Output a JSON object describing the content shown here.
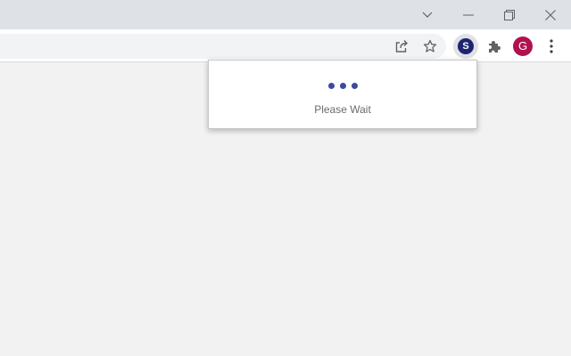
{
  "window": {
    "controls": [
      {
        "name": "tab-search",
        "icon": "chevron-down-icon"
      },
      {
        "name": "minimize",
        "icon": "minimize-icon"
      },
      {
        "name": "restore",
        "icon": "restore-icon"
      },
      {
        "name": "close",
        "icon": "close-icon"
      }
    ]
  },
  "toolbar": {
    "share_icon": "share-icon",
    "bookmark_icon": "star-icon",
    "extension_badge": "S",
    "extension_color": "#1d2570",
    "extensions_icon": "puzzle-icon",
    "profile_initial": "G",
    "profile_color": "#b0124f",
    "menu_icon": "kebab-menu-icon"
  },
  "popup": {
    "message": "Please Wait",
    "dot_color": "#3c4aa0",
    "dot_count": 3
  }
}
